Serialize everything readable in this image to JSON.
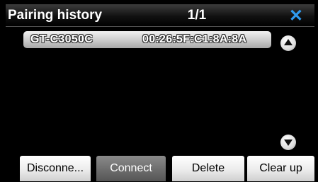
{
  "header": {
    "title": "Pairing history",
    "page_indicator": "1/1",
    "close_icon": "close-icon",
    "close_color": "#2f9bf0"
  },
  "devices": [
    {
      "name": "GT-C3050C",
      "mac": "00:26:5F:C1:8A:8A"
    }
  ],
  "scroll": {
    "up_icon": "chevron-up-icon",
    "down_icon": "chevron-down-icon"
  },
  "buttons": {
    "disconnect": "Disconne...",
    "connect": "Connect",
    "delete": "Delete",
    "clear": "Clear up"
  }
}
